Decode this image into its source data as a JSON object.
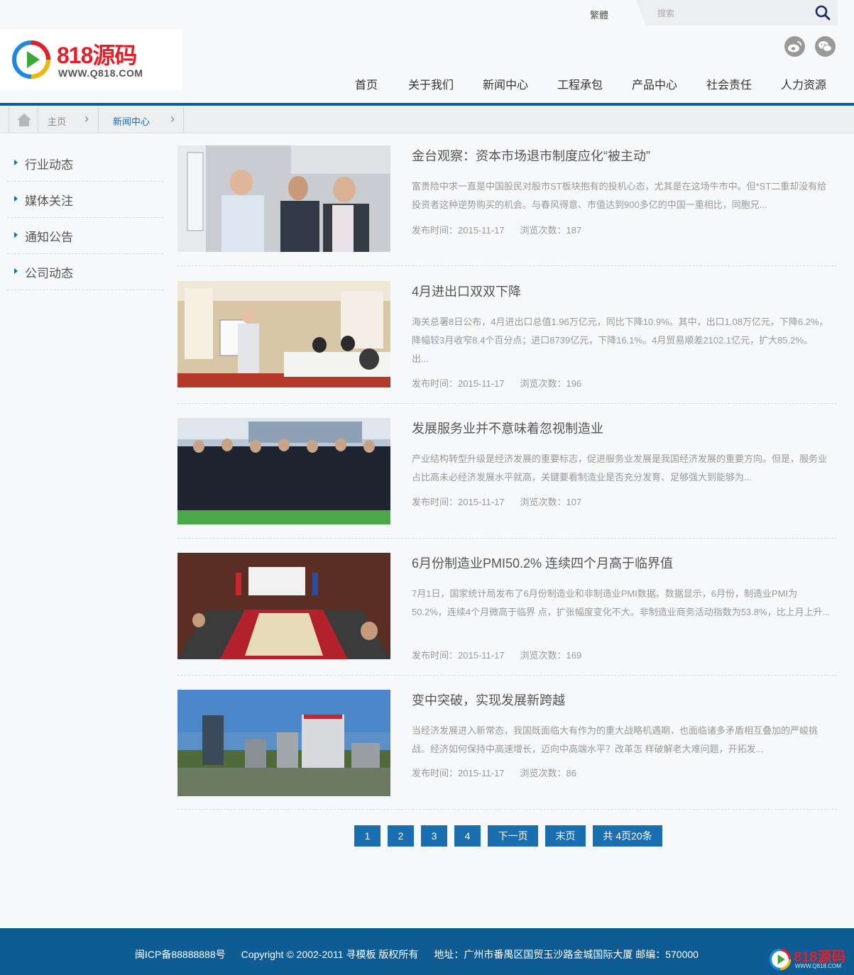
{
  "topbar": {
    "lang_label": "繁體",
    "search_placeholder": "搜索"
  },
  "brand": {
    "name": "818源码",
    "url": "WWW.Q818.COM"
  },
  "nav": {
    "items": [
      {
        "label": "首页"
      },
      {
        "label": "关于我们"
      },
      {
        "label": "新闻中心"
      },
      {
        "label": "工程承包"
      },
      {
        "label": "产品中心"
      },
      {
        "label": "社会责任"
      },
      {
        "label": "人力资源"
      }
    ]
  },
  "breadcrumb": {
    "home": "主页",
    "current": "新闻中心"
  },
  "sidebar": {
    "items": [
      {
        "label": "行业动态"
      },
      {
        "label": "媒体关注"
      },
      {
        "label": "通知公告"
      },
      {
        "label": "公司动态"
      }
    ]
  },
  "news": [
    {
      "title": "金台观察：资本市场退市制度应化“被主动”",
      "summary": "富贵险中求一直是中国股民对股市ST板块抱有的投机心态，尤其是在这场牛市中。但*ST二重却没有给投资者这种逆势购买的机会。与春风得意、市值达到900多亿的中国一重相比，同胞兄...",
      "date": "发布时间：2015-11-17",
      "views": "浏览次数：187"
    },
    {
      "title": "4月进出口双双下降",
      "summary": "海关总署8日公布，4月进出口总值1.96万亿元，同比下降10.9%。其中，出口1.08万亿元，下降6.2%，降幅较3月收窄8.4个百分点；进口8739亿元，下降16.1%。4月贸易顺差2102.1亿元，扩大85.2%。 出...",
      "date": "发布时间：2015-11-17",
      "views": "浏览次数：196"
    },
    {
      "title": "发展服务业并不意味着忽视制造业",
      "summary": "产业结构转型升级是经济发展的重要标志，促进服务业发展是我国经济发展的重要方向。但是，服务业占比高未必经济发展水平就高，关键要看制造业是否充分发育、足够强大到能够为...",
      "date": "发布时间：2015-11-17",
      "views": "浏览次数：107"
    },
    {
      "title": "6月份制造业PMI50.2% 连续四个月高于临界值",
      "summary": "7月1日，国家统计局发布了6月份制造业和非制造业PMI数据。数据显示，6月份，制造业PMI为50.2%，连续4个月微高于临界 点，扩张幅度变化不大。非制造业商务活动指数为53.8%，比上月上升...",
      "date": "发布时间：2015-11-17",
      "views": "浏览次数：169"
    },
    {
      "title": "变中突破，实现发展新跨越",
      "summary": "当经济发展进入新常态，我国既面临大有作为的重大战略机遇期，也面临诸多矛盾相互叠加的严峻挑战。经济如何保持中高速增长，迈向中高端水平？改革怎 样破解老大难问题，开拓发...",
      "date": "发布时间：2015-11-17",
      "views": "浏览次数：86"
    }
  ],
  "pager": {
    "pages": [
      "1",
      "2",
      "3",
      "4"
    ],
    "next": "下一页",
    "last": "末页",
    "total": "共 4页20条"
  },
  "footer": {
    "icp": "闽ICP备88888888号",
    "copyright": "Copyright © 2002-2011 寻模板 版权所有",
    "address": "地址：广州市番禺区国贸玉沙路金城国际大厦 邮编：570000"
  },
  "colors": {
    "primary": "#1a6fb0",
    "header_rule": "#0f5c94",
    "footer_bg": "#0f5c94",
    "brand_red": "#e2202a"
  }
}
